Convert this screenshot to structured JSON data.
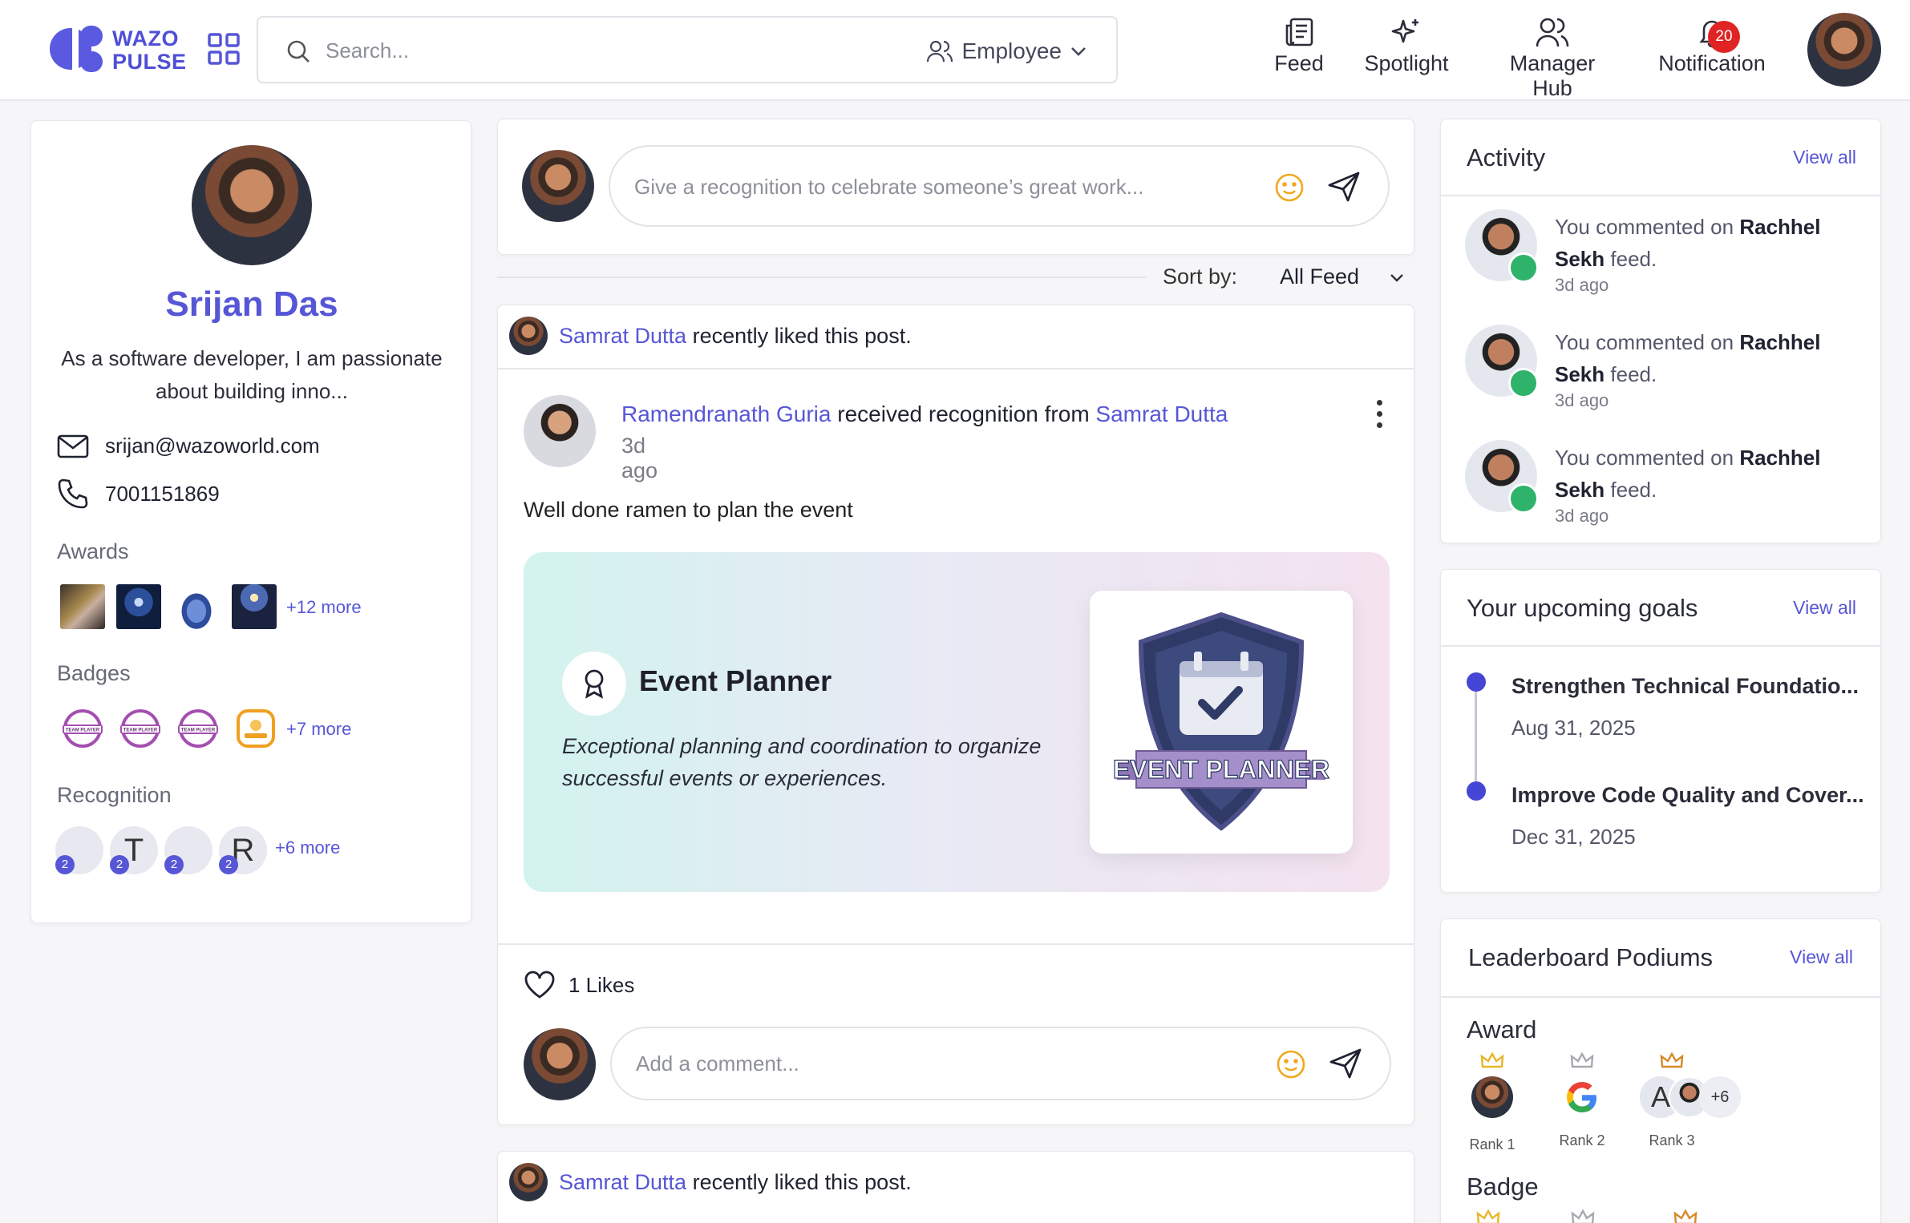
{
  "brand": {
    "line1": "WAZO",
    "line2": "PULSE",
    "color": "#5656d6"
  },
  "search": {
    "placeholder": "Search...",
    "scope": "Employee"
  },
  "nav": [
    {
      "label": "Feed",
      "icon": "newspaper-icon"
    },
    {
      "label": "Spotlight",
      "icon": "sparkle-icon"
    },
    {
      "label": "Manager Hub",
      "icon": "users-icon"
    },
    {
      "label": "Notification",
      "icon": "bell-icon",
      "badge": "20"
    }
  ],
  "profile": {
    "name": "Srijan Das",
    "bio": "As a software developer, I am passionate about building inno...",
    "email": "srijan@wazoworld.com",
    "phone": "7001151869",
    "awards_label": "Awards",
    "awards_more": "+12 more",
    "badges_label": "Badges",
    "badges_more": "+7 more",
    "badge_texts": [
      "TEAM PLAYER",
      "TEAM PLAYER",
      "TEAM PLAYER"
    ],
    "recognition_label": "Recognition",
    "recognition_more": "+6 more",
    "recognition": [
      {
        "initial": "",
        "count": "2"
      },
      {
        "initial": "T",
        "count": "2"
      },
      {
        "initial": "",
        "count": "2"
      },
      {
        "initial": "R",
        "count": "2"
      }
    ]
  },
  "composer": {
    "placeholder": "Give a recognition to celebrate someone’s great work..."
  },
  "sort": {
    "label": "Sort by:",
    "value": "All Feed"
  },
  "post": {
    "liker": "Samrat Dutta",
    "liked_text": "recently liked this post.",
    "recipient": "Ramendranath Guria",
    "received_text": "received recognition",
    "from_text": "from",
    "giver": "Samrat Dutta",
    "time": "3d ago",
    "message": "Well done ramen to plan the event",
    "recognition_title": "Event Planner",
    "recognition_desc": "Exceptional planning and coordination to organize successful events or experiences.",
    "badge_banner": "EVENT PLANNER",
    "likes": "1 Likes",
    "comment_placeholder": "Add a comment..."
  },
  "post2": {
    "liker": "Samrat Dutta",
    "liked_text": "recently liked this post."
  },
  "activity": {
    "title": "Activity",
    "view_all": "View all",
    "items": [
      {
        "prefix": "You commented on",
        "name": "Rachhel Sekh",
        "suffix": "feed.",
        "time": "3d ago"
      },
      {
        "prefix": "You commented on",
        "name": "Rachhel Sekh",
        "suffix": "feed.",
        "time": "3d ago"
      },
      {
        "prefix": "You commented on",
        "name": "Rachhel Sekh",
        "suffix": "feed.",
        "time": "3d ago"
      }
    ]
  },
  "goals": {
    "title": "Your upcoming goals",
    "view_all": "View all",
    "items": [
      {
        "title": "Strengthen Technical Foundatio...",
        "date": "Aug 31, 2025"
      },
      {
        "title": "Improve Code Quality and Cover...",
        "date": "Dec 31, 2025"
      }
    ]
  },
  "leaderboard": {
    "title": "Leaderboard Podiums",
    "view_all": "View all",
    "award_label": "Award",
    "badge_label": "Badge",
    "ranks": [
      "Rank 1",
      "Rank 2",
      "Rank 3"
    ],
    "rank3_initial": "A",
    "rank3_extra": "+6"
  }
}
